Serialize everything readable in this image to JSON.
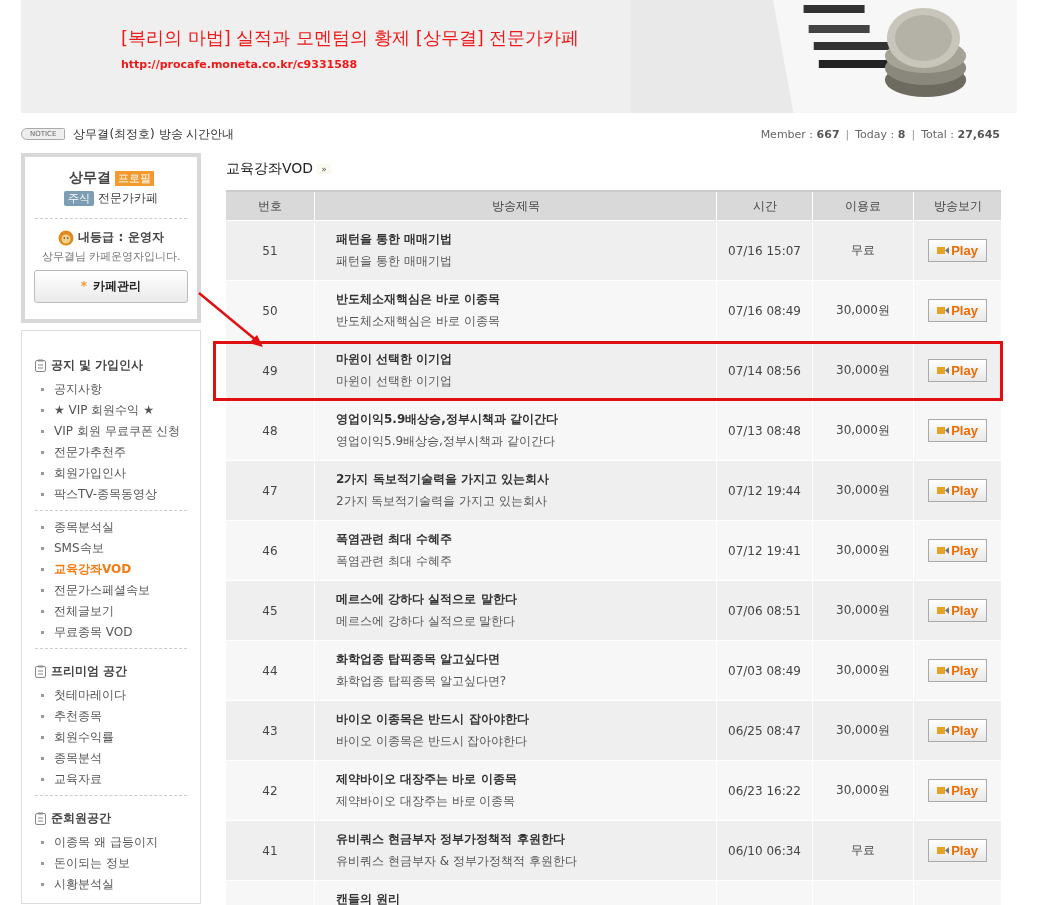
{
  "banner": {
    "title": "[복리의 마법] 실적과 모멘텀의 황제 [상무결] 전문가카페",
    "url": "http://procafe.moneta.co.kr/c9331588"
  },
  "notice": {
    "badge": "NOTICE",
    "text": "상무결(최정호) 방송 시간안내"
  },
  "stats": [
    {
      "label": "Member :",
      "value": "667"
    },
    {
      "label": "Today :",
      "value": "8"
    },
    {
      "label": "Total :",
      "value": "27,645"
    }
  ],
  "stats_separator": "|",
  "profile": {
    "name": "상무결",
    "profile_tag": "프로필",
    "category_tag": "주식",
    "cafe_type": "전문가카페",
    "grade": "내등급 : 운영자",
    "grade_note": "상무결님 카페운영자입니다.",
    "manage_mark": "*",
    "manage_button": "카페관리"
  },
  "menu": [
    {
      "title": "공지 및 가입인사",
      "items": [
        {
          "label": "공지사항",
          "selected": false
        },
        {
          "label": "★ VIP 회원수익 ★",
          "selected": false
        },
        {
          "label": "VIP 회원 무료쿠폰 신청",
          "selected": false
        },
        {
          "label": "전문가추천주",
          "selected": false
        },
        {
          "label": "회원가입인사",
          "selected": false
        },
        {
          "label": "팍스TV-종목동영상",
          "selected": false
        }
      ]
    },
    {
      "items": [
        {
          "label": "종목분석실",
          "selected": false
        },
        {
          "label": "SMS속보",
          "selected": false
        },
        {
          "label": "교육강좌VOD",
          "selected": true
        },
        {
          "label": "전문가스페셜속보",
          "selected": false
        },
        {
          "label": "전체글보기",
          "selected": false
        },
        {
          "label": "무료종목 VOD",
          "selected": false
        }
      ]
    },
    {
      "title": "프리미엄 공간",
      "items": [
        {
          "label": "첫테마레이다",
          "selected": false
        },
        {
          "label": "추천종목",
          "selected": false
        },
        {
          "label": "회원수익률",
          "selected": false
        },
        {
          "label": "종목분석",
          "selected": false
        },
        {
          "label": "교육자료",
          "selected": false
        }
      ]
    },
    {
      "title": "준회원공간",
      "items": [
        {
          "label": "이종목 왜 급등이지",
          "selected": false
        },
        {
          "label": "돈이되는 정보",
          "selected": false
        },
        {
          "label": "시황분석실",
          "selected": false
        }
      ]
    }
  ],
  "board": {
    "title": "교육강좌VOD",
    "title_mark": "»",
    "columns": [
      "번호",
      "방송제목",
      "시간",
      "이용료",
      "방송보기"
    ],
    "rows": [
      {
        "num": "51",
        "title": "패턴을 통한 매매기법",
        "subtitle": "패턴을 통한 매매기법",
        "time": "07/16 15:07",
        "fee": "무료",
        "button": "Play",
        "highlighted": false
      },
      {
        "num": "50",
        "title": "반도체소재핵심은 바로 이종목",
        "subtitle": "반도체소재핵심은 바로 이종목",
        "time": "07/16 08:49",
        "fee": "30,000원",
        "button": "Play",
        "highlighted": false
      },
      {
        "num": "49",
        "title": "마윈이 선택한 이기업",
        "subtitle": "마윈이 선택한 이기업",
        "time": "07/14 08:56",
        "fee": "30,000원",
        "button": "Play",
        "highlighted": true
      },
      {
        "num": "48",
        "title": "영업이익5.9배상승,정부시책과 같이간다",
        "subtitle": "영업이익5.9배상승,정부시책과 같이간다",
        "time": "07/13 08:48",
        "fee": "30,000원",
        "button": "Play",
        "highlighted": false
      },
      {
        "num": "47",
        "title": "2가지 독보적기술력을 가지고 있는회사",
        "subtitle": "2가지 독보적기술력을 가지고 있는회사",
        "time": "07/12 19:44",
        "fee": "30,000원",
        "button": "Play",
        "highlighted": false
      },
      {
        "num": "46",
        "title": "폭염관련 최대 수혜주",
        "subtitle": "폭염관련 최대 수혜주",
        "time": "07/12 19:41",
        "fee": "30,000원",
        "button": "Play",
        "highlighted": false
      },
      {
        "num": "45",
        "title": "메르스에 강하다 실적으로 말한다",
        "subtitle": "메르스에 강하다 실적으로 말한다",
        "time": "07/06 08:51",
        "fee": "30,000원",
        "button": "Play",
        "highlighted": false
      },
      {
        "num": "44",
        "title": "화학업종 탑픽종목 알고싶다면",
        "subtitle": "화학업종 탑픽종목 알고싶다면?",
        "time": "07/03 08:49",
        "fee": "30,000원",
        "button": "Play",
        "highlighted": false
      },
      {
        "num": "43",
        "title": "바이오 이종목은 반드시 잡아야한다",
        "subtitle": "바이오 이종목은 반드시 잡아야한다",
        "time": "06/25 08:47",
        "fee": "30,000원",
        "button": "Play",
        "highlighted": false
      },
      {
        "num": "42",
        "title": "제약바이오 대장주는 바로 이종목",
        "subtitle": "제약바이오 대장주는 바로 이종목",
        "time": "06/23 16:22",
        "fee": "30,000원",
        "button": "Play",
        "highlighted": false
      },
      {
        "num": "41",
        "title": "유비쿼스 현금부자 정부가정책적 후원한다",
        "subtitle": "유비쿼스 현금부자 & 정부가정책적 후원한다",
        "time": "06/10 06:34",
        "fee": "무료",
        "button": "Play",
        "highlighted": false
      },
      {
        "title": "캔들의 원리",
        "highlighted": false
      }
    ]
  }
}
